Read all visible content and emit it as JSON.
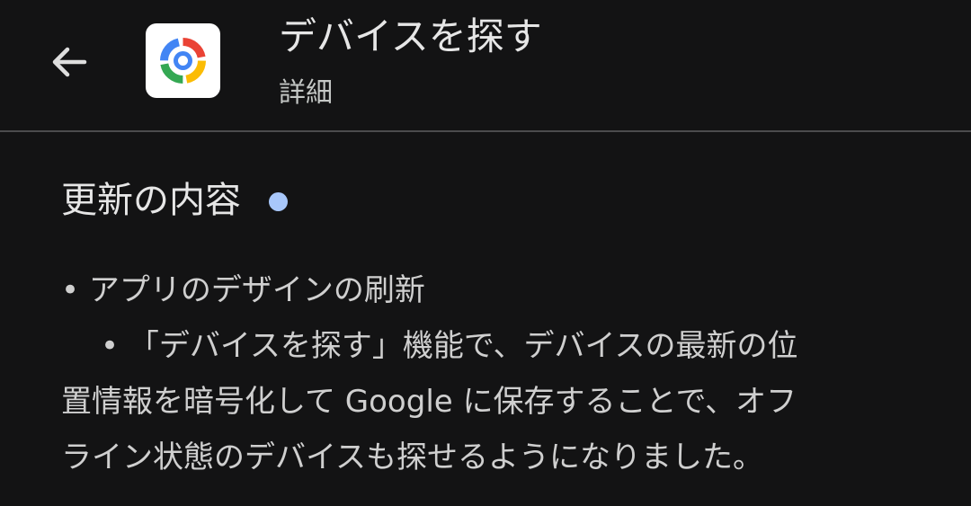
{
  "header": {
    "title": "デバイスを探す",
    "subtitle": "詳細",
    "back_icon": "arrow-left-icon",
    "app_icon": "find-my-device-icon"
  },
  "section": {
    "title": "更新の内容",
    "new_indicator_color": "#a8c7fa"
  },
  "content": {
    "lines": [
      "• アプリのデザインの刷新",
      "• 「デバイスを探す」機能で、デバイスの最新の位",
      "置情報を暗号化して Google に保存することで、オフ",
      "ライン状態のデバイスも探せるようになりました。"
    ]
  },
  "colors": {
    "background": "#131314",
    "text": "#e3e3e3",
    "divider": "#4b4b4d"
  }
}
